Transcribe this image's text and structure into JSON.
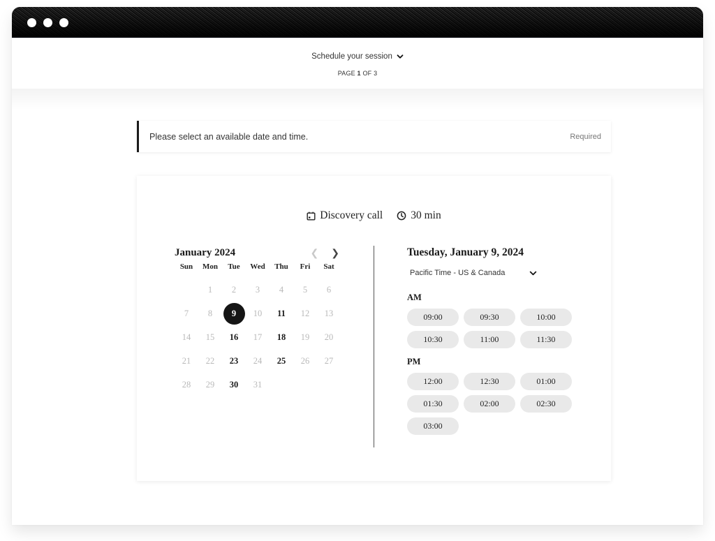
{
  "window": {
    "controls": [
      "dot",
      "dot",
      "dot"
    ]
  },
  "header": {
    "title": "Schedule your session",
    "title_icon": "chevron-down-icon",
    "page_prefix": "PAGE ",
    "page_current": "1",
    "page_suffix": " OF 3"
  },
  "notice": {
    "text": "Please select an available date and time.",
    "required_label": "Required"
  },
  "service": {
    "name": "Discovery call",
    "name_icon": "calendar-icon",
    "duration": "30 min",
    "duration_icon": "clock-icon"
  },
  "calendar": {
    "month_label": "January 2024",
    "prev_icon": "chevron-left-icon",
    "next_icon": "chevron-right-icon",
    "weekdays": [
      "Sun",
      "Mon",
      "Tue",
      "Wed",
      "Thu",
      "Fri",
      "Sat"
    ],
    "leading_blank_days": 1,
    "days": [
      {
        "n": "1",
        "state": "disabled"
      },
      {
        "n": "2",
        "state": "disabled"
      },
      {
        "n": "3",
        "state": "disabled"
      },
      {
        "n": "4",
        "state": "disabled"
      },
      {
        "n": "5",
        "state": "disabled"
      },
      {
        "n": "6",
        "state": "disabled"
      },
      {
        "n": "7",
        "state": "disabled"
      },
      {
        "n": "8",
        "state": "disabled"
      },
      {
        "n": "9",
        "state": "selected"
      },
      {
        "n": "10",
        "state": "disabled"
      },
      {
        "n": "11",
        "state": "available"
      },
      {
        "n": "12",
        "state": "disabled"
      },
      {
        "n": "13",
        "state": "disabled"
      },
      {
        "n": "14",
        "state": "disabled"
      },
      {
        "n": "15",
        "state": "disabled"
      },
      {
        "n": "16",
        "state": "available"
      },
      {
        "n": "17",
        "state": "disabled"
      },
      {
        "n": "18",
        "state": "available"
      },
      {
        "n": "19",
        "state": "disabled"
      },
      {
        "n": "20",
        "state": "disabled"
      },
      {
        "n": "21",
        "state": "disabled"
      },
      {
        "n": "22",
        "state": "disabled"
      },
      {
        "n": "23",
        "state": "available"
      },
      {
        "n": "24",
        "state": "disabled"
      },
      {
        "n": "25",
        "state": "available"
      },
      {
        "n": "26",
        "state": "disabled"
      },
      {
        "n": "27",
        "state": "disabled"
      },
      {
        "n": "28",
        "state": "disabled"
      },
      {
        "n": "29",
        "state": "disabled"
      },
      {
        "n": "30",
        "state": "available"
      },
      {
        "n": "31",
        "state": "disabled"
      }
    ]
  },
  "slots": {
    "date_label": "Tuesday, January 9, 2024",
    "timezone": "Pacific Time - US & Canada",
    "am_label": "AM",
    "pm_label": "PM",
    "am": [
      "09:00",
      "09:30",
      "10:00",
      "10:30",
      "11:00",
      "11:30"
    ],
    "pm": [
      "12:00",
      "12:30",
      "01:00",
      "01:30",
      "02:00",
      "02:30",
      "03:00"
    ]
  },
  "colors": {
    "accent": "#151515",
    "slot_bg": "#e9e9e9",
    "disabled_day": "#b9b9b9"
  }
}
